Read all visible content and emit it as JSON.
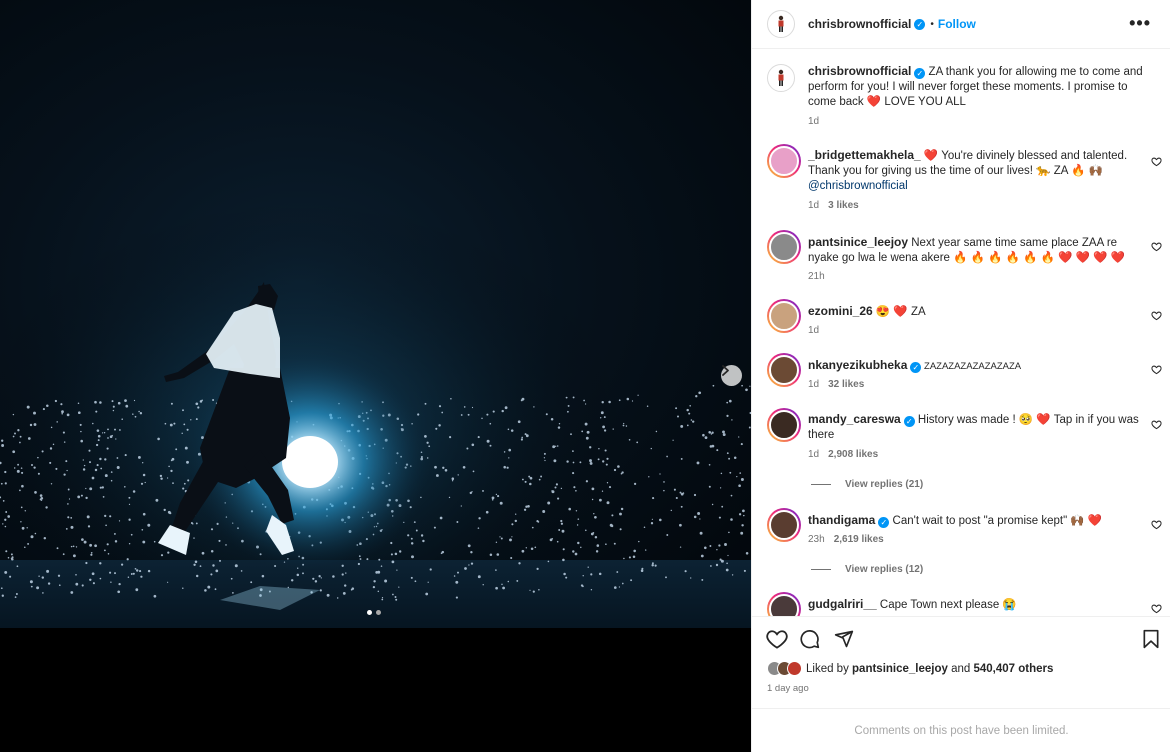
{
  "header": {
    "username": "chrisbrownofficial",
    "separator": "•",
    "follow_label": "Follow",
    "more_label": "•••"
  },
  "caption": {
    "username": "chrisbrownofficial",
    "text_a": " ZA thank you for allowing me to come and perform for you! I will never forget these moments. I promise to come back ",
    "heart": "❤️",
    "text_b": " LOVE YOU ALL",
    "time": "1d"
  },
  "comments": [
    {
      "username": "_bridgettemakhela_",
      "text_a": " ",
      "heart": "❤️",
      "text_b": " You're divinely blessed and talented. Thank you for giving us the time of our lives! 🐆 ZA 🔥 🙌🏾",
      "mention": "@chrisbrownofficial",
      "time": "1d",
      "likes": "3 likes",
      "avatar_color": "#e8a0c8"
    },
    {
      "username": "pantsinice_leejoy",
      "text_a": " Next year same time same place ZAA re nyake go lwa le wena akere 🔥 🔥 🔥 🔥 🔥 🔥 ",
      "hearts": "❤️ ❤️ ❤️ ❤️",
      "time": "21h",
      "avatar_color": "#8a8a8a"
    },
    {
      "username": "ezomini_26",
      "text_a": " 😍 ",
      "heart": "❤️",
      "text_b": " ZA",
      "time": "1d",
      "avatar_color": "#c9a27e"
    },
    {
      "username": "nkanyezikubheka",
      "text_a": " ZAZAZAZAZAZAZAZA",
      "time": "1d",
      "likes": "32 likes",
      "avatar_color": "#6b4a34"
    },
    {
      "username": "mandy_careswa",
      "text_a": " History was made ! 🥺 ",
      "heart": "❤️",
      "text_b": " Tap in if you was there",
      "time": "1d",
      "likes": "2,908 likes",
      "replies": "View replies (21)",
      "avatar_color": "#3a2a22"
    },
    {
      "username": "thandigama",
      "text_a": " Can't wait to post \"a promise kept\" 🙌🏾 ",
      "heart": "❤️",
      "time": "23h",
      "likes": "2,619 likes",
      "replies": "View replies (12)",
      "avatar_color": "#5a3d30"
    },
    {
      "username": "gudgalriri__",
      "text_a": " Cape Town next please 😭",
      "avatar_color": "#4a3a3a"
    }
  ],
  "likes": {
    "prefix": "Liked by ",
    "user": "pantsinice_leejoy",
    "middle": " and ",
    "count": "540,407 others"
  },
  "time_ago": "1 day ago",
  "limited_notice": "Comments on this post have been limited.",
  "carousel": {
    "current": 1,
    "total": 2
  },
  "colors": {
    "accent": "#0095f6",
    "heart": "#ed4956",
    "muted": "#737373"
  },
  "icons": [
    "more-icon",
    "heart-icon",
    "comment-icon",
    "share-icon",
    "bookmark-icon",
    "chevron-right-icon",
    "verified-icon"
  ]
}
